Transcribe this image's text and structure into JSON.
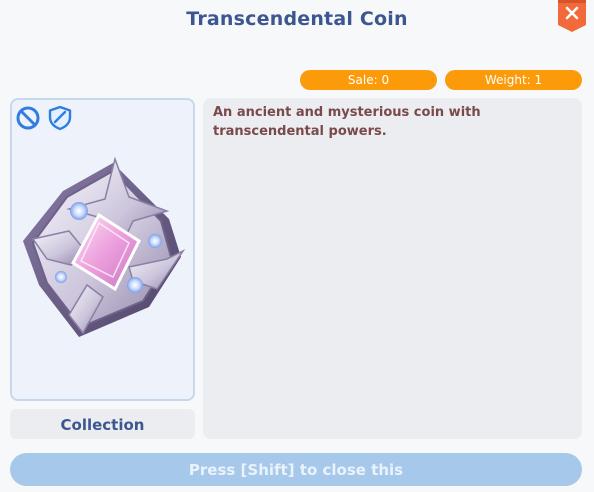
{
  "title": "Transcendental Coin",
  "stats": {
    "sale_label": "Sale: 0",
    "weight_label": "Weight: 1"
  },
  "item": {
    "status_icons": [
      "no-trade-icon",
      "shield-icon"
    ],
    "image": "transcendental-coin-icon"
  },
  "collection_label": "Collection",
  "description": "An ancient and mysterious coin with transcendental powers.",
  "footer": {
    "close_hint": "Press [Shift] to close this"
  },
  "colors": {
    "title": "#3c5690",
    "close_button": "#f26a3a",
    "stat_pill": "#fb9b0a",
    "description_text": "#7a4a4a",
    "close_bar": "#a6c8ea",
    "panel_border": "#c8d8ec"
  }
}
